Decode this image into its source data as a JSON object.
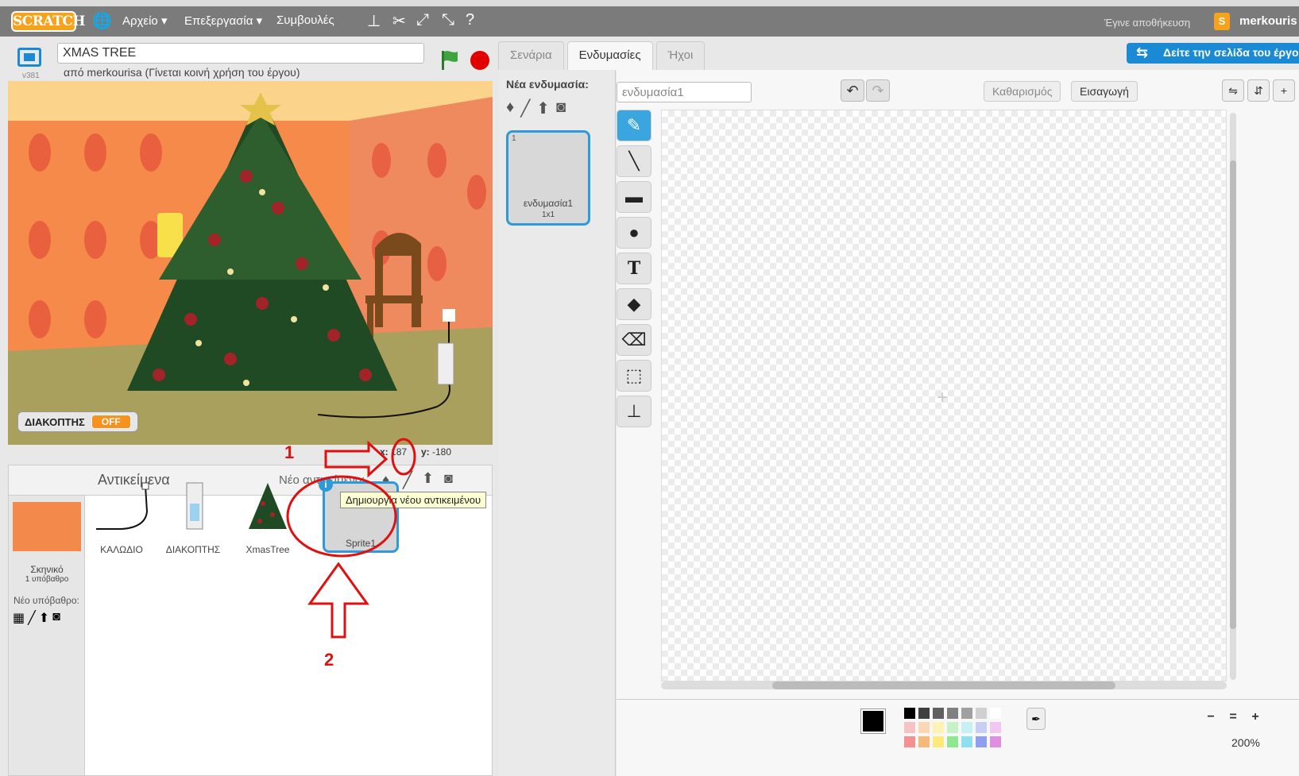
{
  "menubar": {
    "logo": "SCRATCH",
    "file": "Αρχείο ▾",
    "edit": "Επεξεργασία ▾",
    "tips": "Συμβουλές",
    "saved": "Έγινε αποθήκευση",
    "user": "merkouris"
  },
  "stage_header": {
    "version": "v381",
    "project_title": "XMAS TREE",
    "author": "από merkourisa (Γίνεται κοινή χρήση του έργου)"
  },
  "monitor": {
    "label": "ΔΙΑΚΟΠΤΗΣ",
    "value": "OFF"
  },
  "coords": {
    "x_label": "x:",
    "x_value": "187",
    "y_label": "y:",
    "y_value": "-180"
  },
  "sprites": {
    "title": "Αντικείμενα",
    "new_label": "Νέο αντικείμενο:",
    "stage_name": "Σκηνικό",
    "stage_sub": "1 υπόβαθρο",
    "new_backdrop": "Νέο υπόβαθρο:",
    "items": [
      {
        "name": "ΚΑΛΩΔΙΟ"
      },
      {
        "name": "ΔΙΑΚΟΠΤΗΣ"
      },
      {
        "name": "XmasTree"
      },
      {
        "name": "Sprite1"
      }
    ],
    "tooltip": "Δημιουργία νέου αντικειμένου"
  },
  "tabs": [
    "Σενάρια",
    "Ενδυμασίες",
    "Ήχοι"
  ],
  "share_button": "Δείτε την σελίδα του έργου",
  "costumes": {
    "new_label": "Νέα ενδυμασία:",
    "items": [
      {
        "num": "1",
        "name": "ενδυμασία1",
        "size": "1x1"
      }
    ]
  },
  "editor": {
    "costume_name": "ενδυμασία1",
    "clear": "Καθαρισμός",
    "import": "Εισαγωγή",
    "zoom": "200%"
  },
  "annotations": {
    "one": "1",
    "two": "2"
  },
  "colors": {
    "accent": "#1a8ad4",
    "highlight": "#e01010",
    "menubar": "#7b7b7b",
    "palette": [
      "#000000",
      "#404040",
      "#606060",
      "#808080",
      "#a0a0a0",
      "#d0d0d0",
      "#ffffff",
      "#f6c2c2",
      "#fbd7b3",
      "#fff2b3",
      "#c7f2c7",
      "#c7f0f5",
      "#c7cff5",
      "#f0c7f0",
      "#f59090",
      "#f7b979",
      "#ffe979",
      "#8ee88e",
      "#8ee0f0",
      "#8e9ef0",
      "#e08ee0"
    ]
  }
}
